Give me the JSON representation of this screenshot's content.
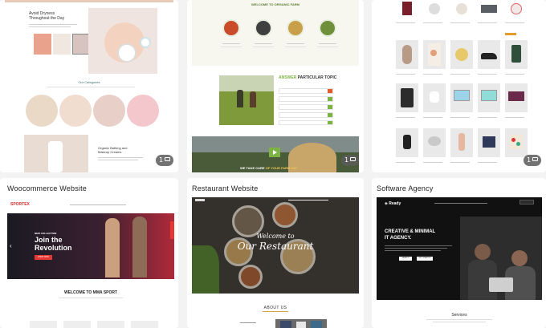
{
  "cards_top": [
    {
      "id": "beauty",
      "hero_title": "Avoid Dryness\nThroughout the Day",
      "categories_heading": "Our Categories",
      "product_title": "Organic Bathing and\nMakeup Creams",
      "badge_count": "1"
    },
    {
      "id": "farm",
      "welcome_title": "WELCOME TO ORGANIC FARM",
      "topic_title_prefix": "ANSWER",
      "topic_title_rest": " PARTICULAR TOPIC",
      "banner_text_a": "WE TAKE CARE",
      "banner_text_b": "OF YOUR FARM 24/7",
      "badge_count": "1"
    },
    {
      "id": "shop",
      "badge_count": "1"
    }
  ],
  "cards_bottom": [
    {
      "id": "woocommerce",
      "title": "Woocommerce Website",
      "brand": "SPORTEX",
      "hero_small": "NEW COLLECTION",
      "hero_line1": "Join the",
      "hero_line2": "Revolution",
      "hero_button": "SHOP NOW",
      "section_title": "WELCOME TO MMA SPORT"
    },
    {
      "id": "restaurant",
      "title": "Restaurant Website",
      "hero_line1": "Welcome to",
      "hero_line2": "Our Restaurant",
      "about_title": "ABOUT US"
    },
    {
      "id": "software",
      "title": "Software Agency",
      "brand": "Ready",
      "hero_line1": "CREATIVE & MINIMAL",
      "hero_line2": "IT AGENCY.",
      "button_a": "SEARCH",
      "button_b": "GET STARTED",
      "section_title": "Services"
    }
  ],
  "colors": {
    "page_bg": "#f3f3f4",
    "farm_green": "#7cb342",
    "restaurant_dark": "#2b2b2b",
    "woo_red": "#e53935",
    "agency_black": "#111111"
  }
}
